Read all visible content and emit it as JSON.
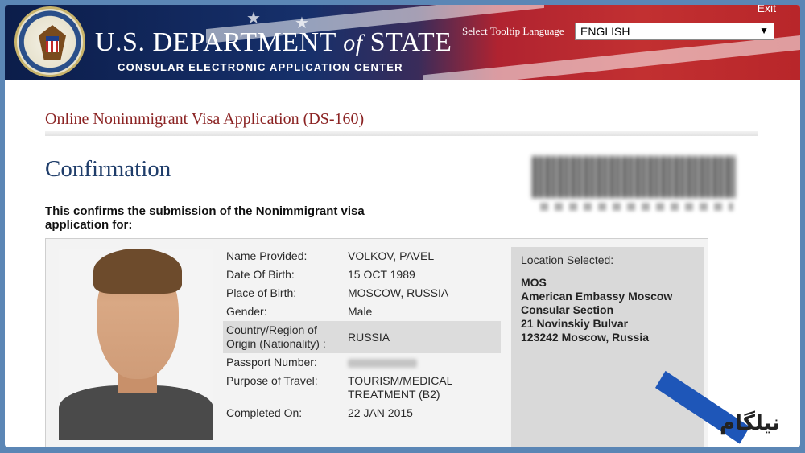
{
  "header": {
    "exit_label": "Exit",
    "dept_prefix": "U.S. DEPARTMENT",
    "dept_of": "of",
    "dept_suffix": "STATE",
    "subtitle": "CONSULAR ELECTRONIC APPLICATION CENTER",
    "tooltip_label": "Select Tooltip Language",
    "language_selected": "ENGLISH",
    "seal_icon": "state-department-seal-icon"
  },
  "page": {
    "app_title": "Online Nonimmigrant Visa Application (DS-160)",
    "heading": "Confirmation",
    "confirm_text": "This confirms the submission of the Nonimmigrant visa application for:"
  },
  "applicant": {
    "rows": [
      {
        "label": "Name Provided:",
        "value": "VOLKOV, PAVEL"
      },
      {
        "label": "Date Of Birth:",
        "value": "15 OCT 1989"
      },
      {
        "label": "Place of Birth:",
        "value": "MOSCOW, RUSSIA"
      },
      {
        "label": "Gender:",
        "value": "Male"
      },
      {
        "label": "Country/Region of Origin (Nationality) :",
        "value": "RUSSIA"
      },
      {
        "label": "Passport Number:",
        "value": ""
      },
      {
        "label": "Purpose of Travel:",
        "value": "TOURISM/MEDICAL TREATMENT (B2)"
      },
      {
        "label": "Completed On:",
        "value": "22 JAN 2015"
      }
    ]
  },
  "location": {
    "label": "Location Selected:",
    "line1": "MOS",
    "line2": "American Embassy Moscow",
    "line3": "Consular Section",
    "line4": "21 Novinskiy Bulvar",
    "line5": "123242 Moscow, Russia"
  },
  "watermark": {
    "text": "نیلگام",
    "logo_icon": "nilgam-logo-icon",
    "brand_color": "#1e56b8"
  }
}
